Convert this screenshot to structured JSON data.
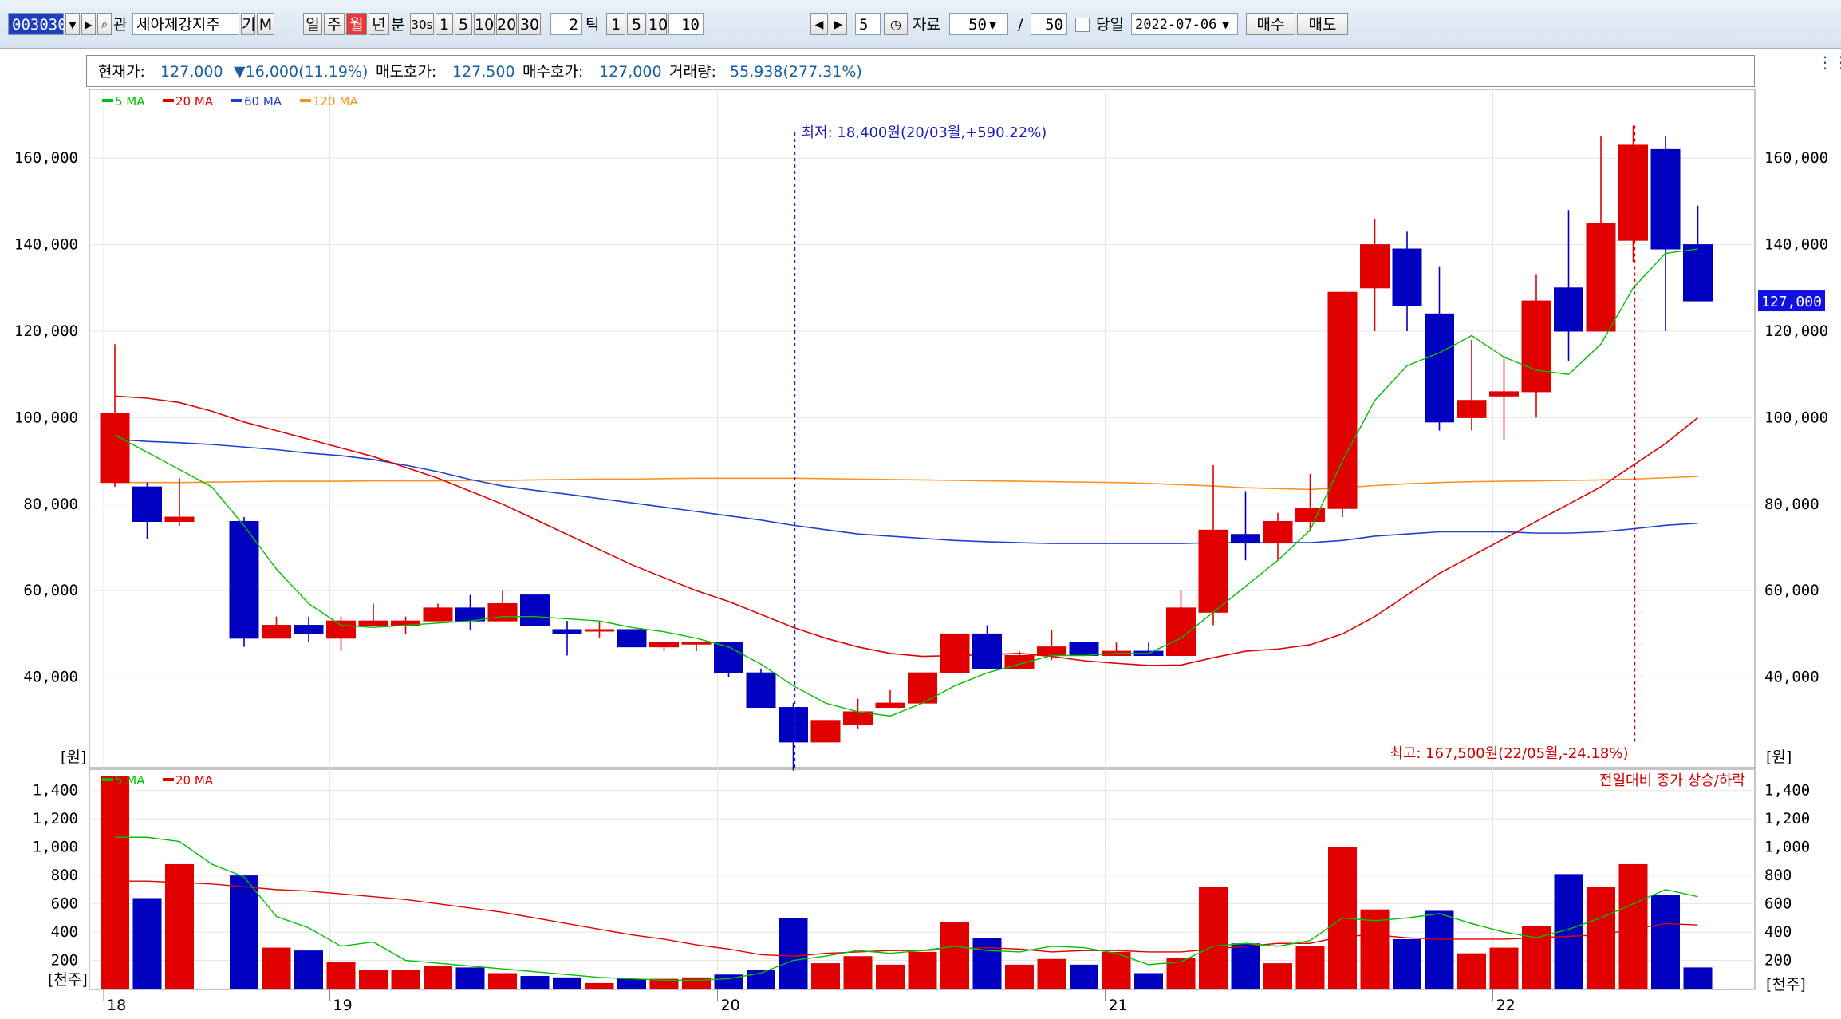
{
  "toolbar": {
    "code": "003030",
    "name": "세아제강지주",
    "search_icon": "magnifier-icon",
    "gwan": "관",
    "gi": "기",
    "m": "M",
    "periods": [
      "일",
      "주",
      "월",
      "년",
      "분",
      "30s",
      "1",
      "5",
      "10",
      "20",
      "30"
    ],
    "active_period": "월",
    "tick_value": "2",
    "tick_label": "틱",
    "tick_options": [
      "1",
      "5",
      "10",
      "10"
    ],
    "step_value": "5",
    "data_label": "자료",
    "data_count": "50",
    "slash": "/",
    "data_total": "50",
    "today_label": "당일",
    "date": "2022-07-06",
    "buy_label": "매수",
    "sell_label": "매도"
  },
  "info": {
    "price_label": "현재가:",
    "price": "127,000",
    "change": "▼16,000(11.19%)",
    "ask_label": "매도호가:",
    "ask": "127,500",
    "bid_label": "매수호가:",
    "bid": "127,000",
    "volume_label": "거래량:",
    "volume": "55,938(277.31%)"
  },
  "colors": {
    "up": "#e00000",
    "down": "#0000c0",
    "ma5": "#00c000",
    "ma20": "#e00000",
    "ma60": "#2040d0",
    "ma120": "#ff9020"
  },
  "price_legend": [
    {
      "name": "5 MA",
      "color": "#00c000"
    },
    {
      "name": "20 MA",
      "color": "#e00000"
    },
    {
      "name": "60 MA",
      "color": "#2040d0"
    },
    {
      "name": "120 MA",
      "color": "#ff9020"
    }
  ],
  "volume_legend": [
    {
      "name": "5 MA",
      "color": "#00c000"
    },
    {
      "name": "20 MA",
      "color": "#e00000"
    }
  ],
  "annotations": {
    "low": "최저: 18,400원(20/03월,+590.22%)",
    "high": "최고: 167,500원(22/05월,-24.18%)",
    "vol_note": "전일대비 종가 상승/하락",
    "unit_price": "[원]",
    "unit_volume": "[천주]",
    "current_price": "127,000"
  },
  "chart_data": {
    "type": "candlestick",
    "y_ticks": [
      "160,000",
      "140,000",
      "120,000",
      "100,000",
      "80,000",
      "60,000",
      "40,000"
    ],
    "ylim": [
      20000,
      170000
    ],
    "vol_ticks": [
      "1,400",
      "1,200",
      "1,000",
      "800",
      "600",
      "400",
      "200"
    ],
    "vol_ylim": [
      0,
      1500
    ],
    "x_labels": [
      {
        "label": "18",
        "i": 0
      },
      {
        "label": "19",
        "i": 7
      },
      {
        "label": "20",
        "i": 19
      },
      {
        "label": "21",
        "i": 31
      },
      {
        "label": "22",
        "i": 43
      }
    ],
    "candles": [
      {
        "o": 85000,
        "h": 117000,
        "l": 84000,
        "c": 101000,
        "v": 1500
      },
      {
        "o": 84000,
        "h": 85000,
        "l": 72000,
        "c": 76000,
        "v": 640
      },
      {
        "o": 76000,
        "h": 86000,
        "l": 75000,
        "c": 77000,
        "v": 880
      },
      {
        "o": 76000,
        "h": 76000,
        "l": 76000,
        "c": 76000,
        "v": 0
      },
      {
        "o": 76000,
        "h": 77000,
        "l": 47000,
        "c": 49000,
        "v": 800
      },
      {
        "o": 49000,
        "h": 54000,
        "l": 49000,
        "c": 52000,
        "v": 290
      },
      {
        "o": 52000,
        "h": 54000,
        "l": 48000,
        "c": 50000,
        "v": 270
      },
      {
        "o": 49000,
        "h": 54000,
        "l": 46000,
        "c": 53000,
        "v": 190
      },
      {
        "o": 52000,
        "h": 57000,
        "l": 52000,
        "c": 53000,
        "v": 130
      },
      {
        "o": 52000,
        "h": 54000,
        "l": 50000,
        "c": 53000,
        "v": 130
      },
      {
        "o": 53000,
        "h": 57000,
        "l": 53000,
        "c": 56000,
        "v": 160
      },
      {
        "o": 56000,
        "h": 59000,
        "l": 51000,
        "c": 53000,
        "v": 150
      },
      {
        "o": 53000,
        "h": 60000,
        "l": 53000,
        "c": 57000,
        "v": 110
      },
      {
        "o": 59000,
        "h": 59000,
        "l": 52000,
        "c": 52000,
        "v": 90
      },
      {
        "o": 51000,
        "h": 53000,
        "l": 45000,
        "c": 50000,
        "v": 80
      },
      {
        "o": 51000,
        "h": 53000,
        "l": 49000,
        "c": 51000,
        "v": 40
      },
      {
        "o": 51000,
        "h": 51000,
        "l": 47000,
        "c": 47000,
        "v": 70
      },
      {
        "o": 47000,
        "h": 48000,
        "l": 46000,
        "c": 48000,
        "v": 70
      },
      {
        "o": 48000,
        "h": 48000,
        "l": 46000,
        "c": 48000,
        "v": 80
      },
      {
        "o": 48000,
        "h": 48000,
        "l": 40000,
        "c": 41000,
        "v": 100
      },
      {
        "o": 41000,
        "h": 42000,
        "l": 33000,
        "c": 33000,
        "v": 130
      },
      {
        "o": 33000,
        "h": 34000,
        "l": 18400,
        "c": 25000,
        "v": 500
      },
      {
        "o": 25000,
        "h": 30000,
        "l": 25000,
        "c": 30000,
        "v": 180
      },
      {
        "o": 29000,
        "h": 35000,
        "l": 28000,
        "c": 32000,
        "v": 230
      },
      {
        "o": 33000,
        "h": 37000,
        "l": 33000,
        "c": 34000,
        "v": 170
      },
      {
        "o": 34000,
        "h": 41000,
        "l": 34000,
        "c": 41000,
        "v": 260
      },
      {
        "o": 41000,
        "h": 50000,
        "l": 41000,
        "c": 50000,
        "v": 470
      },
      {
        "o": 50000,
        "h": 52000,
        "l": 42000,
        "c": 42000,
        "v": 360
      },
      {
        "o": 42000,
        "h": 46000,
        "l": 42000,
        "c": 45000,
        "v": 170
      },
      {
        "o": 45000,
        "h": 51000,
        "l": 44000,
        "c": 47000,
        "v": 210
      },
      {
        "o": 48000,
        "h": 48000,
        "l": 45000,
        "c": 45000,
        "v": 170
      },
      {
        "o": 45000,
        "h": 48000,
        "l": 45000,
        "c": 46000,
        "v": 260
      },
      {
        "o": 46000,
        "h": 48000,
        "l": 45000,
        "c": 45000,
        "v": 110
      },
      {
        "o": 45000,
        "h": 60000,
        "l": 45000,
        "c": 56000,
        "v": 220
      },
      {
        "o": 55000,
        "h": 89000,
        "l": 52000,
        "c": 74000,
        "v": 720
      },
      {
        "o": 73000,
        "h": 83000,
        "l": 67000,
        "c": 71000,
        "v": 320
      },
      {
        "o": 71000,
        "h": 78000,
        "l": 67000,
        "c": 76000,
        "v": 180
      },
      {
        "o": 76000,
        "h": 87000,
        "l": 74000,
        "c": 79000,
        "v": 300
      },
      {
        "o": 79000,
        "h": 129000,
        "l": 77000,
        "c": 129000,
        "v": 1000
      },
      {
        "o": 130000,
        "h": 146000,
        "l": 120000,
        "c": 140000,
        "v": 560
      },
      {
        "o": 139000,
        "h": 143000,
        "l": 120000,
        "c": 126000,
        "v": 350
      },
      {
        "o": 124000,
        "h": 135000,
        "l": 97000,
        "c": 99000,
        "v": 550
      },
      {
        "o": 100000,
        "h": 118000,
        "l": 97000,
        "c": 104000,
        "v": 250
      },
      {
        "o": 105000,
        "h": 114000,
        "l": 95000,
        "c": 106000,
        "v": 290
      },
      {
        "o": 106000,
        "h": 133000,
        "l": 100000,
        "c": 127000,
        "v": 440
      },
      {
        "o": 130000,
        "h": 148000,
        "l": 113000,
        "c": 120000,
        "v": 810
      },
      {
        "o": 120000,
        "h": 165000,
        "l": 120000,
        "c": 145000,
        "v": 720
      },
      {
        "o": 141000,
        "h": 167500,
        "l": 136000,
        "c": 163000,
        "v": 880
      },
      {
        "o": 162000,
        "h": 165000,
        "l": 120000,
        "c": 139000,
        "v": 660
      },
      {
        "o": 140000,
        "h": 149000,
        "l": 127000,
        "c": 127000,
        "v": 150
      }
    ],
    "ma5": [
      96000,
      92000,
      88000,
      84000,
      75000,
      65000,
      57000,
      52000,
      51500,
      52000,
      52500,
      53000,
      54000,
      54000,
      53500,
      53000,
      51500,
      50500,
      49000,
      47000,
      43000,
      38000,
      34000,
      32000,
      31000,
      34000,
      38000,
      41000,
      43000,
      45000,
      45000,
      45500,
      45500,
      49000,
      55000,
      61000,
      67000,
      74000,
      90000,
      104000,
      112000,
      115000,
      119000,
      114000,
      111000,
      110000,
      117000,
      130000,
      138000,
      139000
    ],
    "ma20": [
      105000,
      104500,
      103500,
      101500,
      99000,
      97000,
      95000,
      93000,
      91000,
      88500,
      86000,
      83000,
      80000,
      76500,
      73000,
      69500,
      66000,
      63000,
      60000,
      57500,
      54500,
      51500,
      49000,
      47000,
      45500,
      44800,
      45000,
      45200,
      45500,
      44800,
      43800,
      43200,
      42700,
      42800,
      44500,
      46000,
      46500,
      47500,
      50000,
      54000,
      59000,
      64000,
      68000,
      72000,
      76000,
      80000,
      84000,
      89000,
      94000,
      100000
    ],
    "ma60": [
      95000,
      94500,
      94200,
      93800,
      93200,
      92600,
      91800,
      91200,
      90300,
      89000,
      87500,
      85700,
      84200,
      83200,
      82300,
      81300,
      80300,
      79300,
      78300,
      77300,
      76300,
      75100,
      74100,
      73100,
      72600,
      72100,
      71600,
      71300,
      71100,
      70900,
      70900,
      70900,
      70900,
      70900,
      71100,
      71100,
      71100,
      71100,
      71600,
      72600,
      73100,
      73600,
      73600,
      73600,
      73300,
      73300,
      73600,
      74300,
      75100,
      75600
    ],
    "ma120": [
      85000,
      85000,
      85000,
      85100,
      85200,
      85300,
      85300,
      85300,
      85400,
      85400,
      85400,
      85500,
      85500,
      85600,
      85700,
      85800,
      85800,
      85900,
      86000,
      86000,
      86000,
      86000,
      85900,
      85800,
      85700,
      85600,
      85500,
      85400,
      85300,
      85200,
      85100,
      85000,
      84800,
      84500,
      84200,
      83800,
      83600,
      83400,
      83800,
      84300,
      84700,
      85000,
      85200,
      85300,
      85400,
      85500,
      85600,
      85800,
      86100,
      86400
    ],
    "vol_ma5": [
      1070,
      1070,
      1040,
      880,
      790,
      510,
      430,
      300,
      330,
      200,
      180,
      160,
      140,
      120,
      100,
      80,
      70,
      60,
      60,
      70,
      110,
      200,
      230,
      270,
      250,
      270,
      300,
      270,
      260,
      300,
      290,
      250,
      170,
      190,
      300,
      320,
      300,
      340,
      500,
      480,
      500,
      530,
      460,
      400,
      360,
      420,
      500,
      600,
      700,
      650
    ],
    "vol_ma20": [
      760,
      760,
      750,
      740,
      720,
      700,
      690,
      670,
      650,
      630,
      600,
      570,
      540,
      500,
      460,
      420,
      380,
      350,
      310,
      280,
      240,
      230,
      250,
      260,
      270,
      270,
      280,
      290,
      280,
      260,
      270,
      270,
      260,
      260,
      280,
      300,
      320,
      320,
      370,
      380,
      360,
      350,
      350,
      350,
      360,
      370,
      380,
      420,
      460,
      450
    ]
  }
}
